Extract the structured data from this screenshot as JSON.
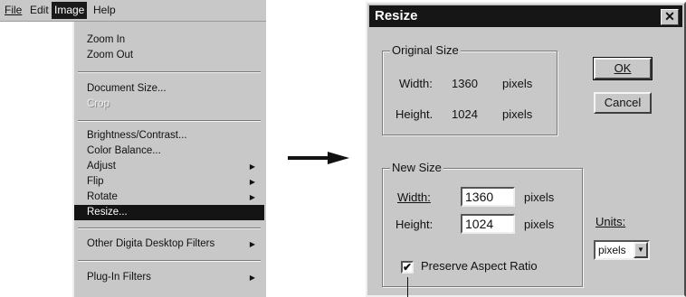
{
  "menubar": {
    "items": [
      {
        "label": "File",
        "accel_index": 0
      },
      {
        "label": "Edit",
        "accel_index": 0
      },
      {
        "label": "Image",
        "accel_index": 0
      },
      {
        "label": "Help",
        "accel_index": 0
      }
    ]
  },
  "image_menu": {
    "zoom_in": "Zoom In",
    "zoom_out": "Zoom Out",
    "document_size": "Document Size...",
    "crop": "Crop",
    "brightness_contrast": "Brightness/Contrast...",
    "color_balance": "Color Balance...",
    "adjust": "Adjust",
    "flip": "Flip",
    "rotate": "Rotate",
    "resize": "Resize...",
    "other_filters": "Other Digita Desktop Filters",
    "plugin_filters": "Plug-In Filters"
  },
  "dialog": {
    "title": "Resize",
    "close_glyph": "✕",
    "original_size": {
      "legend": "Original Size",
      "width_label": "Width:",
      "width_value": "1360",
      "width_unit": "pixels",
      "height_label": "Height.",
      "height_value": "1024",
      "height_unit": "pixels"
    },
    "new_size": {
      "legend": "New Size",
      "width_label": "Width:",
      "width_value": "1360",
      "width_unit": "pixels",
      "height_label": "Height:",
      "height_value": "1024",
      "height_unit": "pixels",
      "preserve_label": "Preserve Aspect Ratio",
      "preserve_checked": true,
      "check_glyph": "✔"
    },
    "units_label": "Units:",
    "units_value": "pixels",
    "ok_label": "OK",
    "cancel_label": "Cancel"
  },
  "icons": {
    "arrow": "arrow-right-icon",
    "submenu": "▶",
    "dropdown": "▼"
  }
}
